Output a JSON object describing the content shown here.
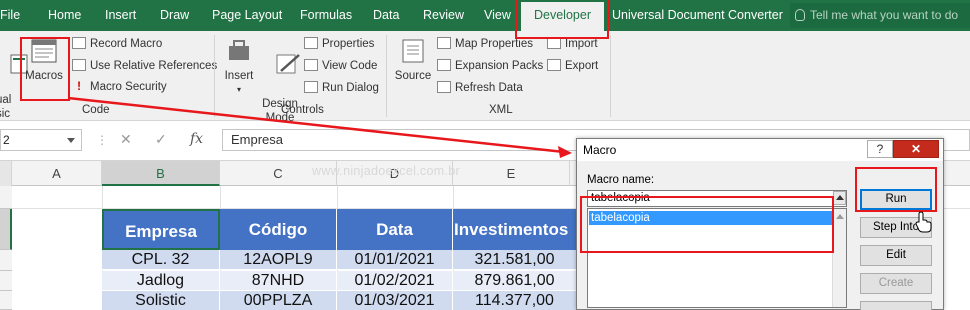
{
  "ribbon_tabs": [
    "File",
    "Home",
    "Insert",
    "Draw",
    "Page Layout",
    "Formulas",
    "Data",
    "Review",
    "View",
    "Developer",
    "Universal Document Converter"
  ],
  "active_tab": "Developer",
  "tell_me_placeholder": "Tell me what you want to do",
  "ribbon": {
    "code_group": {
      "visual_basic_label": "ual\nsic",
      "macros_label": "Macros",
      "record_macro": "Record Macro",
      "use_relative_references": "Use Relative References",
      "macro_security": "Macro Security",
      "group_label": "Code"
    },
    "controls_group": {
      "insert_label": "Insert",
      "design_mode_label": "Design\nMode",
      "properties": "Properties",
      "view_code": "View Code",
      "run_dialog": "Run Dialog",
      "group_label": "Controls"
    },
    "xml_group": {
      "source_label": "Source",
      "map_properties": "Map Properties",
      "expansion_packs": "Expansion Packs",
      "refresh_data": "Refresh Data",
      "import": "Import",
      "export": "Export",
      "group_label": "XML"
    }
  },
  "formula_bar": {
    "name_box": "2",
    "formula": "Empresa"
  },
  "columns": [
    "A",
    "B",
    "C",
    "D",
    "E"
  ],
  "selected_column": "B",
  "watermark": "www.ninjadoexcel.com.br",
  "table": {
    "headers": [
      "Empresa",
      "Código",
      "Data",
      "Investimentos"
    ],
    "rows": [
      [
        "CPL. 32",
        "12AOPL9",
        "01/01/2021",
        "321.581,00"
      ],
      [
        "Jadlog",
        "87NHD",
        "01/02/2021",
        "879.861,00"
      ],
      [
        "Solistic",
        "00PPLZA",
        "01/03/2021",
        "114.377,00"
      ]
    ]
  },
  "macro_dialog": {
    "title": "Macro",
    "help_glyph": "?",
    "close_glyph": "✕",
    "macro_name_label": "Macro name:",
    "macro_name_value": "tabelacopia",
    "macro_list": [
      "tabelacopia"
    ],
    "buttons": {
      "run": "Run",
      "step_into": "Step Into",
      "edit": "Edit",
      "create": "Create"
    }
  },
  "colors": {
    "ribbon_green": "#217346",
    "table_header_blue": "#4472c4",
    "annotation_red": "#e8171b",
    "list_selection_blue": "#3399ff"
  },
  "icons": [
    "lightbulb-icon",
    "macros-icon",
    "record-macro-icon",
    "relative-references-icon",
    "macro-security-icon",
    "insert-control-icon",
    "design-mode-icon",
    "properties-icon",
    "view-code-icon",
    "run-dialog-icon",
    "source-icon",
    "map-properties-icon",
    "expansion-packs-icon",
    "refresh-data-icon",
    "import-icon",
    "export-icon",
    "cancel-icon",
    "enter-icon",
    "function-icon",
    "cursor-icon"
  ]
}
